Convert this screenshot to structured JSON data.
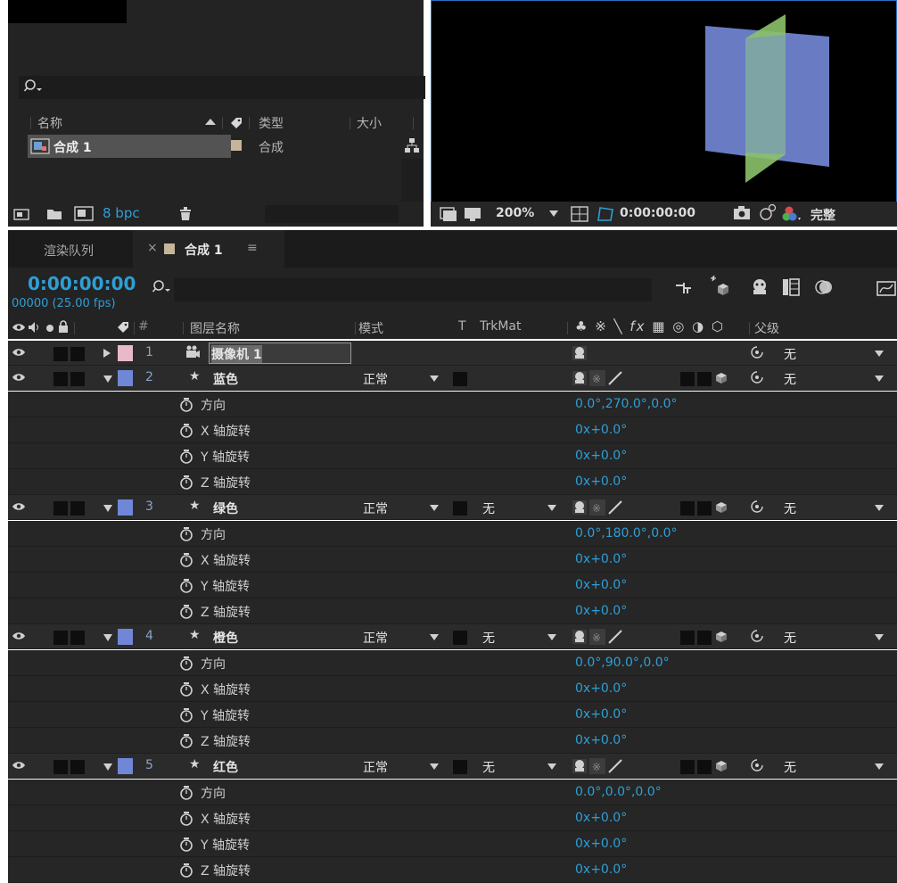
{
  "project_panel": {
    "search_placeholder": "",
    "columns": {
      "name": "名称",
      "type": "类型",
      "size": "大小"
    },
    "items": [
      {
        "name": "合成 1",
        "type": "合成"
      }
    ],
    "bit_depth": "8 bpc"
  },
  "viewer": {
    "zoom": "200%",
    "timecode": "0:00:00:00",
    "resolution": "完整"
  },
  "timeline": {
    "tabs": {
      "render_queue": "渲染队列",
      "comp": "合成 1"
    },
    "timecode": "0:00:00:00",
    "frame_info": "00000 (25.00 fps)",
    "columns": {
      "hash": "#",
      "layer_name": "图层名称",
      "mode": "模式",
      "t": "T",
      "trkmat": "TrkMat",
      "parent": "父级"
    },
    "layers": [
      {
        "num": "1",
        "name": "摄像机 1",
        "label_color": "#e8b9c7",
        "parent": "无"
      },
      {
        "num": "2",
        "name": "蓝色",
        "label_color": "#6f87d6",
        "mode": "正常",
        "parent": "无",
        "props": [
          {
            "name": "方向",
            "value": "0.0°,270.0°,0.0°"
          },
          {
            "name": "X 轴旋转",
            "value": "0x+0.0°"
          },
          {
            "name": "Y 轴旋转",
            "value": "0x+0.0°"
          },
          {
            "name": "Z 轴旋转",
            "value": "0x+0.0°"
          }
        ]
      },
      {
        "num": "3",
        "name": "绿色",
        "label_color": "#6f87d6",
        "mode": "正常",
        "trkmat": "无",
        "parent": "无",
        "props": [
          {
            "name": "方向",
            "value": "0.0°,180.0°,0.0°"
          },
          {
            "name": "X 轴旋转",
            "value": "0x+0.0°"
          },
          {
            "name": "Y 轴旋转",
            "value": "0x+0.0°"
          },
          {
            "name": "Z 轴旋转",
            "value": "0x+0.0°"
          }
        ]
      },
      {
        "num": "4",
        "name": "橙色",
        "label_color": "#6f87d6",
        "mode": "正常",
        "trkmat": "无",
        "parent": "无",
        "props": [
          {
            "name": "方向",
            "value": "0.0°,90.0°,0.0°"
          },
          {
            "name": "X 轴旋转",
            "value": "0x+0.0°"
          },
          {
            "name": "Y 轴旋转",
            "value": "0x+0.0°"
          },
          {
            "name": "Z 轴旋转",
            "value": "0x+0.0°"
          }
        ]
      },
      {
        "num": "5",
        "name": "红色",
        "label_color": "#6f87d6",
        "mode": "正常",
        "trkmat": "无",
        "parent": "无",
        "props": [
          {
            "name": "方向",
            "value": "0.0°,0.0°,0.0°"
          },
          {
            "name": "X 轴旋转",
            "value": "0x+0.0°"
          },
          {
            "name": "Y 轴旋转",
            "value": "0x+0.0°"
          },
          {
            "name": "Z 轴旋转",
            "value": "0x+0.0°"
          }
        ]
      }
    ]
  },
  "colors": {
    "accent": "#2e9fd6",
    "viewer_border": "#2d6fc1",
    "plane_blue": "#7287d4",
    "plane_green": "#8cc26a"
  }
}
